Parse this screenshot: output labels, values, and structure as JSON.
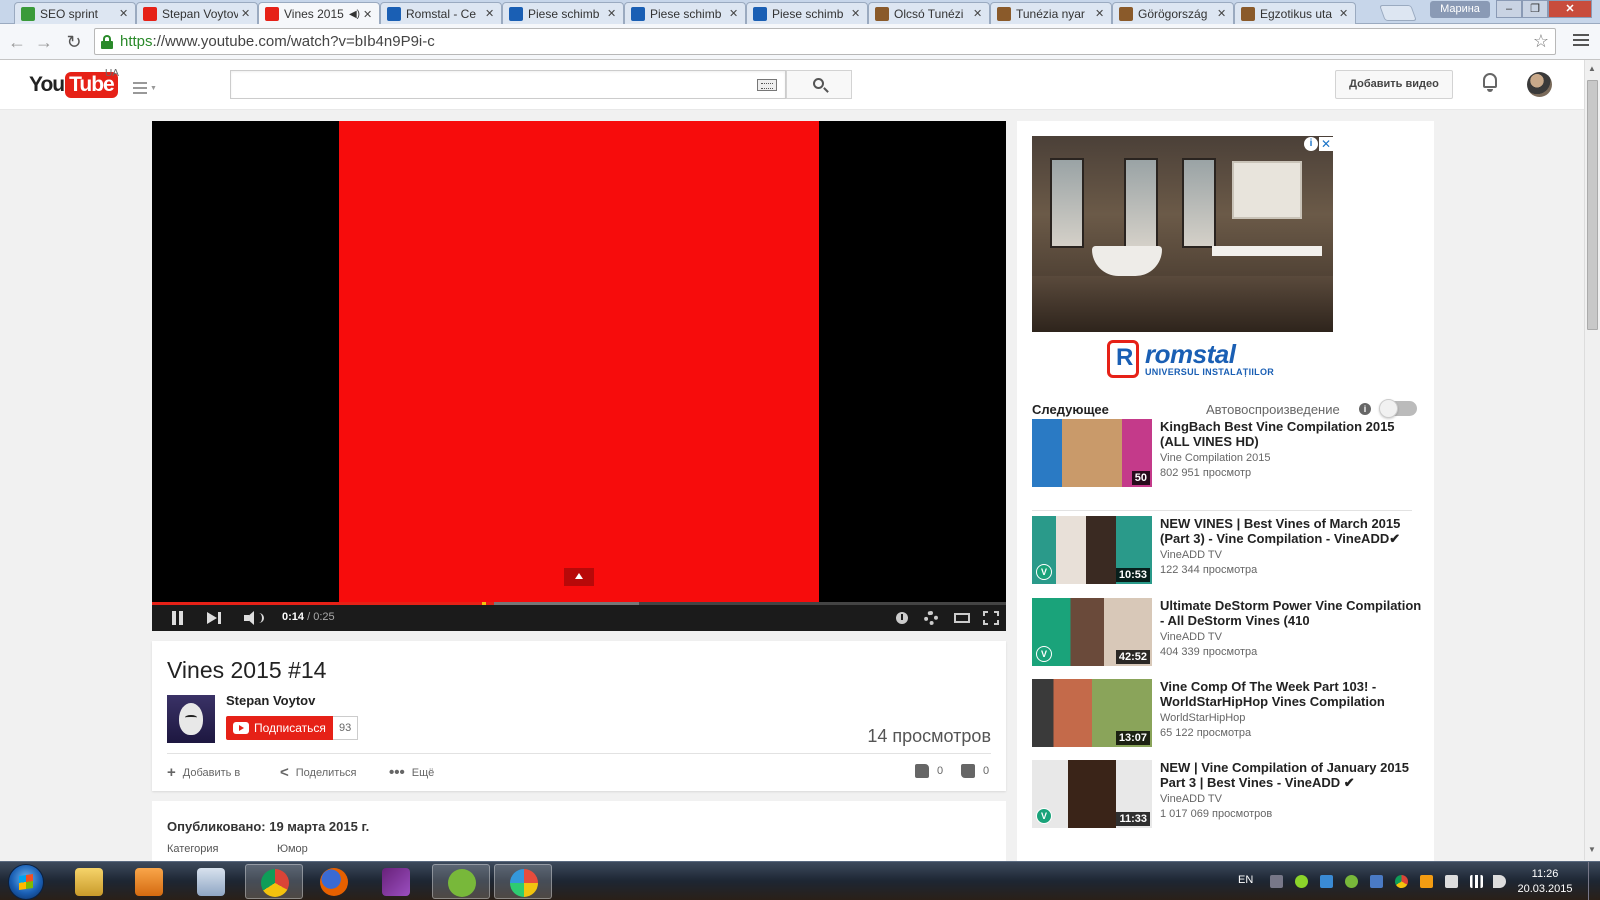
{
  "browser": {
    "tabs": [
      {
        "label": "SEO sprint",
        "favicon": "seo-sprint-favicon",
        "color": "#3a9a3a"
      },
      {
        "label": "Stepan Voytov",
        "favicon": "youtube-favicon",
        "color": "#e62117"
      },
      {
        "label": "Vines 2015",
        "favicon": "youtube-favicon",
        "color": "#e62117",
        "active": true
      },
      {
        "label": "Romstal - Ce",
        "favicon": "romstal-favicon",
        "color": "#1a5fb4"
      },
      {
        "label": "Piese schimb",
        "favicon": "romstal-favicon",
        "color": "#1a5fb4"
      },
      {
        "label": "Piese schimb",
        "favicon": "romstal-favicon",
        "color": "#1a5fb4"
      },
      {
        "label": "Piese schimb",
        "favicon": "romstal-favicon",
        "color": "#1a5fb4"
      },
      {
        "label": "Olcsó Tunézi",
        "favicon": "travel-favicon",
        "color": "#8a5a2a"
      },
      {
        "label": "Tunézia nyar",
        "favicon": "travel-favicon",
        "color": "#8a5a2a"
      },
      {
        "label": "Görögország",
        "favicon": "travel-favicon",
        "color": "#8a5a2a"
      },
      {
        "label": "Egzotikus uta",
        "favicon": "travel-favicon",
        "color": "#8a5a2a"
      }
    ],
    "profile_name": "Марина",
    "url_scheme": "https",
    "url_rest": "://www.youtube.com/watch?v=bIb4n9P9i-c"
  },
  "masthead": {
    "logo_you": "You",
    "logo_tube": "Tube",
    "region": "UA",
    "upload_label": "Добавить видео",
    "search_value": ""
  },
  "player": {
    "time_current": "0:14",
    "time_total": "0:25",
    "progress_played": 0.4,
    "progress_buffered": 0.57
  },
  "video": {
    "title": "Vines 2015 #14",
    "channel": "Stepan Voytov",
    "subscribe_label": "Подписаться",
    "subscriber_count": "93",
    "views": "14 просмотров",
    "actions": {
      "add": "Добавить в",
      "share": "Поделиться",
      "more": "Ещё"
    },
    "likes": "0",
    "dislikes": "0",
    "published": "Опубликовано: 19 марта 2015 г.",
    "category_label": "Категория",
    "category_value": "Юмор"
  },
  "ad": {
    "brand": "romstal",
    "tagline": "UNIVERSUL INSTALAȚIILOR"
  },
  "sidebar": {
    "next_label": "Следующее",
    "autoplay_label": "Автовоспроизведение",
    "autoplay_on": false,
    "videos": [
      {
        "title": "KingBach Best Vine Compilation 2015 (ALL VINES HD)",
        "channel": "Vine Compilation 2015",
        "views": "802 951 просмотр",
        "duration": "50"
      },
      {
        "title": "NEW VINES | Best Vines of March 2015 (Part 3) - Vine Compilation - VineADD✔",
        "channel": "VineADD TV",
        "views": "122 344 просмотра",
        "duration": "10:53"
      },
      {
        "title": "Ultimate DeStorm Power Vine Compilation - All DeStorm Vines (410",
        "channel": "VineADD TV",
        "views": "404 339 просмотра",
        "duration": "42:52"
      },
      {
        "title": "Vine Comp Of The Week Part 103! - WorldStarHipHop Vines Compilation",
        "channel": "WorldStarHipHop",
        "views": "65 122 просмотра",
        "duration": "13:07"
      },
      {
        "title": "NEW | Vine Compilation of January 2015 Part 3 | Best Vines - VineADD ✔",
        "channel": "VineADD TV",
        "views": "1 017 069 просмотров",
        "duration": "11:33"
      }
    ]
  },
  "taskbar": {
    "language": "EN",
    "time": "11:26",
    "date": "20.03.2015"
  }
}
